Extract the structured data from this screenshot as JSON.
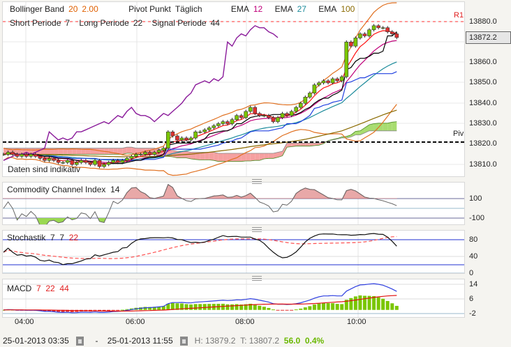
{
  "legend": {
    "bollinger_label": "Bollinger Band",
    "bollinger_period": "20",
    "bollinger_dev": "2.00",
    "pivot_label": "Pivot Punkt",
    "pivot_mode": "Täglich",
    "ema_label": "EMA",
    "ema1": "12",
    "ema2": "27",
    "ema3": "100",
    "short_label": "Short Periode",
    "short_val": "7",
    "long_label": "Long Periode",
    "long_val": "22",
    "signal_label": "Signal Periode",
    "signal_val": "44",
    "disclaimer": "Daten sind indikativ",
    "r1": "R1",
    "piv": "Piv"
  },
  "price_axis": [
    "13880.0",
    "13860.0",
    "13850.0",
    "13840.0",
    "13830.0",
    "13820.0",
    "13810.0"
  ],
  "last_price": "13872.2",
  "cci": {
    "title": "Commodity Channel Index",
    "period": "14",
    "ticks": [
      "100",
      "-100"
    ]
  },
  "stoch": {
    "title": "Stochastik",
    "k": "7",
    "s": "7",
    "d": "22",
    "ticks": [
      "80",
      "40",
      "0"
    ]
  },
  "macd": {
    "title": "MACD",
    "fast": "7",
    "slow": "22",
    "signal": "44",
    "ticks": [
      "14",
      "6",
      "-2"
    ]
  },
  "time_axis": [
    "04:00",
    "06:00",
    "08:00",
    "10:00"
  ],
  "footer": {
    "from": "25-01-2013 03:35",
    "dash": "-",
    "to": "25-01-2013 11:55",
    "high": "H: 13879.2",
    "low": "T: 13807.2",
    "change": "56.0",
    "change_pct": "0.4%"
  },
  "colors": {
    "up": "#7ac600",
    "down": "#e03030",
    "bollinger": "#e07020",
    "ema12": "#c0007a",
    "ema27": "#1a8a9a",
    "ema100": "#8a6a00",
    "chikou": "#8a1a9a",
    "tenkan": "#000000",
    "kijun": "#2040e0",
    "cloud_bear": "#f5a0a0",
    "cloud_bull": "#a8dc70"
  },
  "chart_data": {
    "type": "candlestick",
    "interval": "5min",
    "start": "03:35",
    "pivot": {
      "R1": 13880,
      "Piv": 13821
    },
    "ylim": [
      13805,
      13890
    ],
    "closes": [
      13815,
      13816,
      13815,
      13814,
      13815,
      13814,
      13815,
      13814,
      13813,
      13812,
      13813,
      13812,
      13811,
      13811,
      13812,
      13810,
      13811,
      13812,
      13811,
      13810,
      13812,
      13809,
      13810,
      13811,
      13812,
      13811,
      13812,
      13813,
      13814,
      13815,
      13815,
      13816,
      13815,
      13816,
      13817,
      13818,
      13826,
      13824,
      13822,
      13823,
      13822,
      13823,
      13826,
      13826,
      13827,
      13828,
      13829,
      13830,
      13831,
      13830,
      13832,
      13834,
      13833,
      13836,
      13838,
      13835,
      13834,
      13834,
      13833,
      13831,
      13833,
      13835,
      13834,
      13836,
      13838,
      13840,
      13843,
      13845,
      13849,
      13850,
      13851,
      13850,
      13852,
      13851,
      13853,
      13870,
      13868,
      13872,
      13874,
      13873,
      13876,
      13878,
      13877,
      13877,
      13875,
      13874,
      13872.2
    ]
  }
}
